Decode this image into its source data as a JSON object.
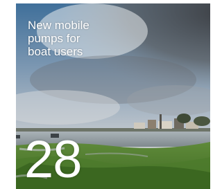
{
  "tile": {
    "headline_lines": [
      "New mobile",
      "pumps for",
      "boat users"
    ],
    "issue_number": "28"
  }
}
